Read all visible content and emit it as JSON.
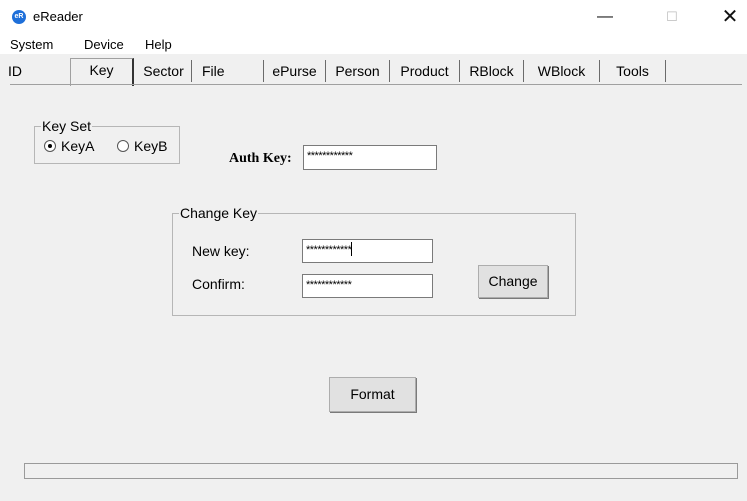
{
  "window": {
    "title": "eReader",
    "icon_text": "eR"
  },
  "menu": [
    "System",
    "Device",
    "Help"
  ],
  "tabs": [
    "ID",
    "Key",
    "Sector",
    "File",
    "ePurse",
    "Person",
    "Product",
    "RBlock",
    "WBlock",
    "Tools"
  ],
  "active_tab": "Key",
  "key_set": {
    "legend": "Key Set",
    "options": [
      "KeyA",
      "KeyB"
    ],
    "selected": "KeyA"
  },
  "auth_key": {
    "label": "Auth Key:",
    "value": "************"
  },
  "change_key": {
    "legend": "Change Key",
    "new_key_label": "New key:",
    "new_key_value": "************",
    "confirm_label": "Confirm:",
    "confirm_value": "************",
    "change_button": "Change"
  },
  "format_button": "Format",
  "window_controls": {
    "minimize": "—",
    "maximize": "☐",
    "close": "✕"
  }
}
